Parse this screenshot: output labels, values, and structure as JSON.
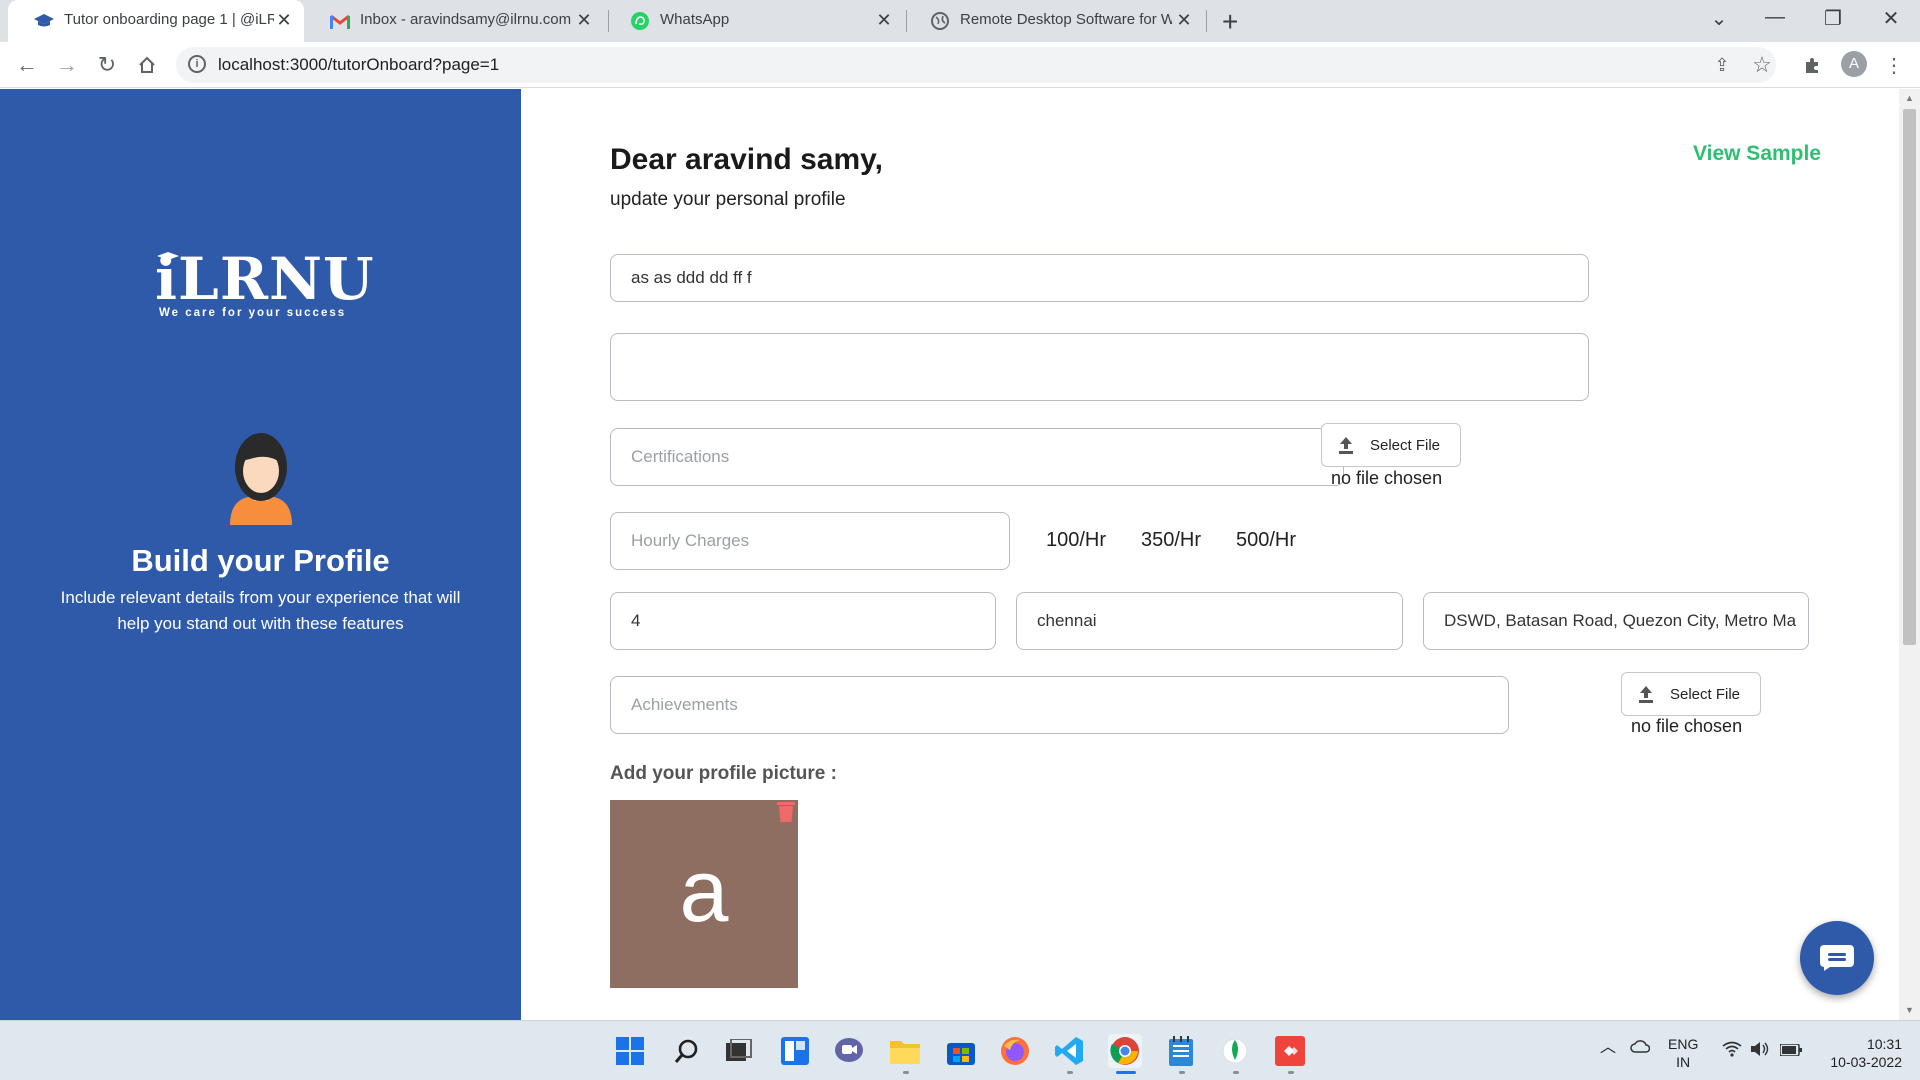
{
  "browser": {
    "tabs": [
      {
        "title": "Tutor onboarding page 1 | @iLRNU",
        "active": true
      },
      {
        "title": "Inbox - aravindsamy@ilrnu.com -",
        "active": false
      },
      {
        "title": "WhatsApp",
        "active": false
      },
      {
        "title": "Remote Desktop Software for Wi",
        "active": false
      }
    ],
    "url": "localhost:3000/tutorOnboard?page=1",
    "profile_initial": "A"
  },
  "sidebar": {
    "logo_text": "iLRNU",
    "tagline": "We care for your success",
    "title": "Build your Profile",
    "description": "Include relevant details from your experience that will help you stand out with these features"
  },
  "form": {
    "greeting": "Dear aravind samy,",
    "subtitle": "update your personal profile",
    "view_sample": "View Sample",
    "about_value": "as as ddd dd ff f",
    "bio_value": "",
    "certifications_placeholder": "Certifications",
    "hourly_placeholder": "Hourly Charges",
    "rates": [
      "100/Hr",
      "350/Hr",
      "500/Hr"
    ],
    "experience_value": "4",
    "city_value": "chennai",
    "address_value": "DSWD, Batasan Road, Quezon City, Metro Ma",
    "achievements_placeholder": "Achievements",
    "select_file_label": "Select File",
    "no_file_text": "no file chosen",
    "profile_picture_label": "Add your profile picture :",
    "profile_initial": "a"
  },
  "taskbar": {
    "language": "ENG",
    "region": "IN",
    "time": "10:31",
    "date": "10-03-2022"
  },
  "colors": {
    "sidebar_bg": "#2e5aa9",
    "accent_green": "#2fbf71",
    "avatar_bg": "#8e6e60"
  }
}
